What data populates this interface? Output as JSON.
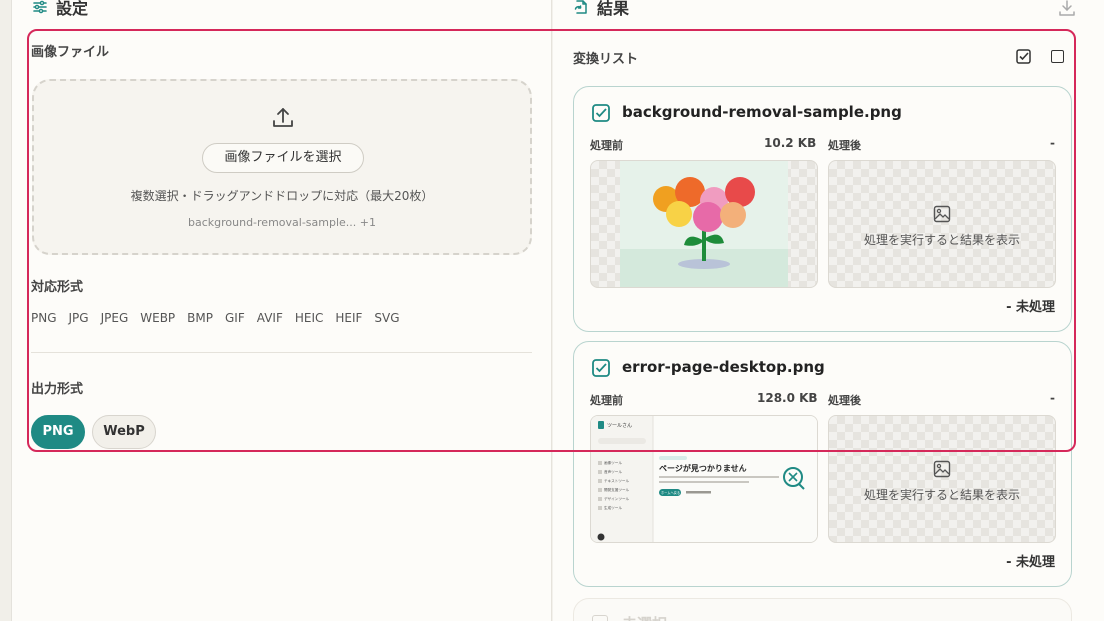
{
  "settings": {
    "title": "設定",
    "image_file_label": "画像ファイル",
    "select_button": "画像ファイルを選択",
    "dropzone_note": "複数選択・ドラッグアンドドロップに対応（最大20枚）",
    "selected_files": "background-removal-sample... +1",
    "supported_label": "対応形式",
    "supported_formats": [
      "PNG",
      "JPG",
      "JPEG",
      "WEBP",
      "BMP",
      "GIF",
      "AVIF",
      "HEIC",
      "HEIF",
      "SVG"
    ],
    "output_label": "出力形式",
    "output_options": [
      "PNG",
      "WebP"
    ],
    "output_selected": "PNG"
  },
  "results": {
    "title": "結果",
    "list_label": "変換リスト",
    "items": [
      {
        "filename": "background-removal-sample.png",
        "before_label": "処理前",
        "before_size": "10.2 KB",
        "after_label": "処理後",
        "after_size": "-",
        "placeholder": "処理を実行すると結果を表示",
        "status": "-  未処理",
        "checked": true
      },
      {
        "filename": "error-page-desktop.png",
        "before_label": "処理前",
        "before_size": "128.0 KB",
        "after_label": "処理後",
        "after_size": "-",
        "placeholder": "処理を実行すると結果を表示",
        "status": "-  未処理",
        "checked": true,
        "preview": {
          "app_name": "ツールさん",
          "heading": "ページが見つかりません",
          "button": "ホームへ戻る",
          "nav": [
            "画像ツール",
            "音声ツール",
            "テキストツール",
            "開発支援ツール",
            "デザインツール",
            "生成ツール"
          ]
        }
      },
      {
        "filename": "未選択",
        "checked": false
      }
    ]
  },
  "colors": {
    "accent": "#1f8a84",
    "highlight": "#d5285a",
    "card_border": "#b9d4cf"
  }
}
